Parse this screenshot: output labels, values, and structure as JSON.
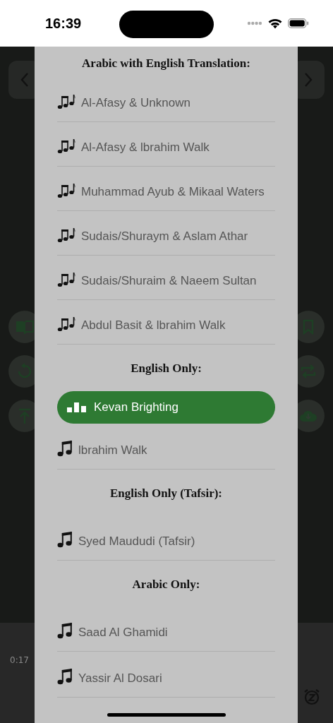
{
  "status_bar": {
    "time": "16:39"
  },
  "player": {
    "elapsed": "0:17"
  },
  "sheet": {
    "sections": [
      {
        "title": "Arabic with English Translation:",
        "kind": "duet",
        "reciters": [
          {
            "name": "Al-Afasy & Unknown",
            "selected": false
          },
          {
            "name": "Al-Afasy & lbrahim Walk",
            "selected": false
          },
          {
            "name": "Muhammad Ayub & Mikaal Waters",
            "selected": false
          },
          {
            "name": "Sudais/Shuraym & Aslam Athar",
            "selected": false
          },
          {
            "name": "Sudais/Shuraim & Naeem Sultan",
            "selected": false
          },
          {
            "name": "Abdul Basit & lbrahim Walk",
            "selected": false
          }
        ]
      },
      {
        "title": "English Only:",
        "kind": "solo",
        "reciters": [
          {
            "name": "Kevan Brighting",
            "selected": true
          },
          {
            "name": "lbrahim Walk",
            "selected": false
          }
        ]
      },
      {
        "title": "English Only (Tafsir):",
        "kind": "solo",
        "reciters": [
          {
            "name": "Syed Maududi (Tafsir)",
            "selected": false
          }
        ]
      },
      {
        "title": "Arabic Only:",
        "kind": "solo",
        "reciters": [
          {
            "name": "Saad Al Ghamidi",
            "selected": false
          },
          {
            "name": "Yassir Al Dosari",
            "selected": false
          }
        ]
      }
    ]
  }
}
